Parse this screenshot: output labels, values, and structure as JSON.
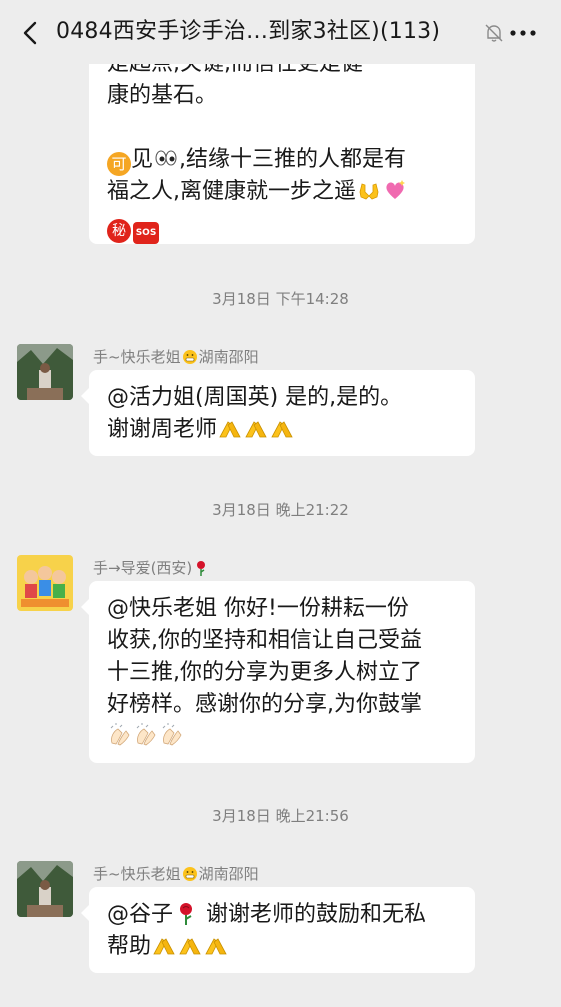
{
  "header": {
    "title": "0484西安手诊手治…到家3社区)(113)",
    "back_icon": "chevron-left-icon",
    "mute_icon": "bell-off-icon",
    "more_icon": "more-dots-icon"
  },
  "messages": [
    {
      "lines": [
        "是起点,关键,而信任更是健",
        "康的基石。",
        "",
        "见",
        "福之人,离健康就一步之遥",
        ""
      ],
      "line1_partial": "是起点,关键,而信任更是健",
      "line2": "康的基石。",
      "line3_text": "见",
      "line3_rest": ",结缘十三推的人都是有",
      "line4": "福之人,离健康就一步之遥",
      "tag_ke": "可",
      "tag_mi": "秘",
      "tag_sos": "SOS"
    }
  ],
  "timestamps": [
    "3月18日 下午14:28",
    "3月18日 晚上21:22",
    "3月18日 晚上21:56"
  ],
  "msg2": {
    "sender": "手~快乐老姐",
    "sender_suffix": "湖南邵阳",
    "line1": "@活力姐(周国英) 是的,是的。",
    "line2": "谢谢周老师"
  },
  "msg3": {
    "sender": "手→导爱(西安)",
    "line1": "@快乐老姐 你好!一份耕耘一份",
    "line2": "收获,你的坚持和相信让自己受益",
    "line3": "十三推,你的分享为更多人树立了",
    "line4": "好榜样。感谢你的分享,为你鼓掌"
  },
  "msg4": {
    "sender": "手~快乐老姐",
    "sender_suffix": "湖南邵阳",
    "line1_a": "@谷子",
    "line1_b": " 谢谢老师的鼓励和无私",
    "line2": "帮助"
  },
  "colors": {
    "background": "#ededed",
    "bubble": "#ffffff",
    "meta_text": "#7f7f7f",
    "text": "#191919"
  }
}
